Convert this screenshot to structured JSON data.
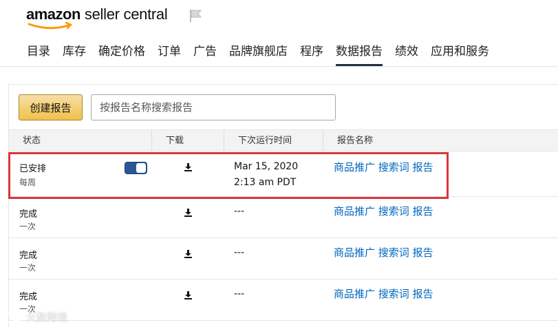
{
  "brand": {
    "logo_amazon": "amazon",
    "logo_suffix": "seller central"
  },
  "nav": [
    {
      "label": "目录",
      "active": false
    },
    {
      "label": "库存",
      "active": false
    },
    {
      "label": "确定价格",
      "active": false
    },
    {
      "label": "订单",
      "active": false
    },
    {
      "label": "广告",
      "active": false
    },
    {
      "label": "品牌旗舰店",
      "active": false
    },
    {
      "label": "程序",
      "active": false
    },
    {
      "label": "数据报告",
      "active": true
    },
    {
      "label": "绩效",
      "active": false
    },
    {
      "label": "应用和服务",
      "active": false
    }
  ],
  "toolbar": {
    "create_label": "创建报告",
    "search_placeholder": "按报告名称搜索报告",
    "search_value": ""
  },
  "table": {
    "headers": {
      "status": "状态",
      "download": "下载",
      "next_run": "下次运行时间",
      "report_name": "报告名称"
    },
    "rows": [
      {
        "status": "已安排",
        "frequency": "每周",
        "toggle_on": true,
        "next_run_line1": "Mar 15, 2020",
        "next_run_line2": "2:13 am PDT",
        "report_name": "商品推广 搜索词 报告"
      },
      {
        "status": "完成",
        "frequency": "一次",
        "toggle_on": false,
        "next_run_line1": "---",
        "next_run_line2": "",
        "report_name": "商品推广 搜索词 报告"
      },
      {
        "status": "完成",
        "frequency": "一次",
        "toggle_on": false,
        "next_run_line1": "---",
        "next_run_line2": "",
        "report_name": "商品推广 搜索词 报告"
      },
      {
        "status": "完成",
        "frequency": "一次",
        "toggle_on": false,
        "next_run_line1": "---",
        "next_run_line2": "",
        "report_name": "商品推广 搜索词 报告"
      }
    ]
  },
  "watermark": {
    "text": "大数跨境"
  },
  "colors": {
    "accent_button": "#f0c14b",
    "link": "#0066c0",
    "toggle": "#2b5797",
    "highlight": "#d9363b"
  },
  "icons": {
    "flag": "flag-icon",
    "download": "download-icon",
    "smile": "amazon-smile-icon"
  }
}
